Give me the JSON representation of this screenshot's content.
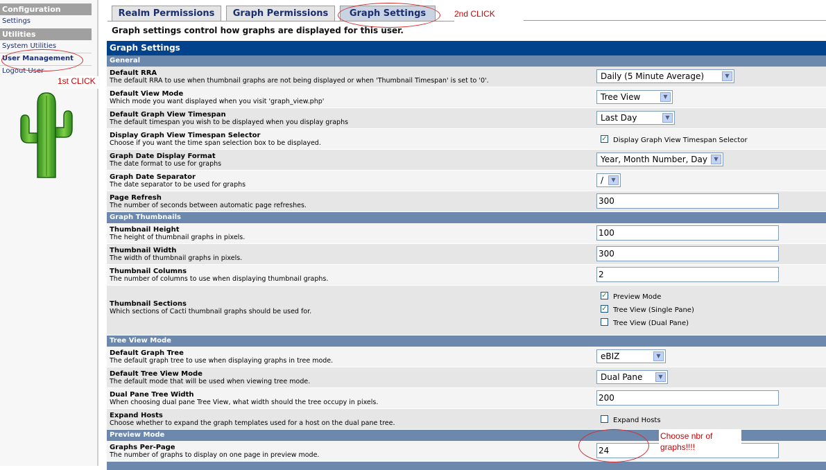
{
  "sidebar": {
    "configuration_header": "Configuration",
    "settings": "Settings",
    "utilities_header": "Utilities",
    "system_utilities": "System Utilities",
    "user_management": "User Management",
    "logout_user": "Logout User"
  },
  "annotations": {
    "first_click": "1st CLICK",
    "second_click": "2nd CLICK",
    "choose_note": "Choose nbr of graphs!!!!"
  },
  "tabs": [
    {
      "label": "Realm Permissions"
    },
    {
      "label": "Graph Permissions"
    },
    {
      "label": "Graph Settings",
      "selected": true
    }
  ],
  "intro": "Graph settings control how graphs are displayed for this user.",
  "main": {
    "title": "Graph Settings",
    "sections": {
      "general": "General",
      "thumbnails": "Graph Thumbnails",
      "tree_view": "Tree View Mode",
      "preview": "Preview Mode"
    },
    "rows": {
      "default_rra": {
        "title": "Default RRA",
        "desc": "The default RRA to use when thumbnail graphs are not being displayed or when 'Thumbnail Timespan' is set to '0'.",
        "value": "Daily (5 Minute Average)"
      },
      "default_view_mode": {
        "title": "Default View Mode",
        "desc": "Which mode you want displayed when you visit 'graph_view.php'",
        "value": "Tree View"
      },
      "default_timespan": {
        "title": "Default Graph View Timespan",
        "desc": "The default timespan you wish to be displayed when you display graphs",
        "value": "Last Day"
      },
      "timespan_selector": {
        "title": "Display Graph View Timespan Selector",
        "desc": "Choose if you want the time span selection box to be displayed.",
        "check_label": "Display Graph View Timespan Selector",
        "checked": true
      },
      "date_format": {
        "title": "Graph Date Display Format",
        "desc": "The date format to use for graphs",
        "value": "Year, Month Number, Day"
      },
      "date_separator": {
        "title": "Graph Date Separator",
        "desc": "The date separator to be used for graphs",
        "value": "/"
      },
      "page_refresh": {
        "title": "Page Refresh",
        "desc": "The number of seconds between automatic page refreshes.",
        "value": "300"
      },
      "thumb_height": {
        "title": "Thumbnail Height",
        "desc": "The height of thumbnail graphs in pixels.",
        "value": "100"
      },
      "thumb_width": {
        "title": "Thumbnail Width",
        "desc": "The width of thumbnail graphs in pixels.",
        "value": "300"
      },
      "thumb_columns": {
        "title": "Thumbnail Columns",
        "desc": "The number of columns to use when displaying thumbnail graphs.",
        "value": "2"
      },
      "thumb_sections": {
        "title": "Thumbnail Sections",
        "desc": "Which sections of Cacti thumbnail graphs should be used for.",
        "preview_label": "Preview Mode",
        "preview_checked": true,
        "single_label": "Tree View (Single Pane)",
        "single_checked": true,
        "dual_label": "Tree View (Dual Pane)",
        "dual_checked": false
      },
      "default_tree": {
        "title": "Default Graph Tree",
        "desc": "The default graph tree to use when displaying graphs in tree mode.",
        "value": "eBIZ"
      },
      "tree_view_mode": {
        "title": "Default Tree View Mode",
        "desc": "The default mode that will be used when viewing tree mode.",
        "value": "Dual Pane"
      },
      "dual_pane_width": {
        "title": "Dual Pane Tree Width",
        "desc": "When choosing dual pane Tree View, what width should the tree occupy in pixels.",
        "value": "200"
      },
      "expand_hosts": {
        "title": "Expand Hosts",
        "desc": "Choose whether to expand the graph templates used for a host on the dual pane tree.",
        "check_label": "Expand Hosts",
        "checked": false
      },
      "graphs_per_page": {
        "title": "Graphs Per-Page",
        "desc": "The number of graphs to display on one page in preview mode.",
        "value": "24"
      }
    }
  },
  "colors": {
    "title_bar": "#00438c",
    "section_bar": "#6d88ad",
    "annotation": "#cc0000"
  }
}
